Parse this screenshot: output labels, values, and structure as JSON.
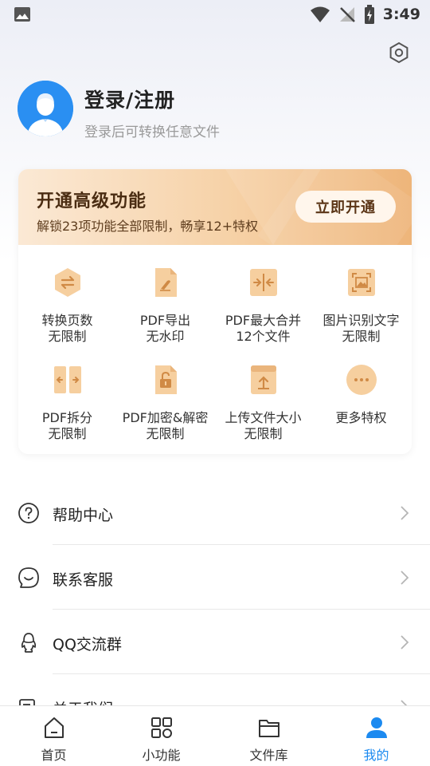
{
  "status_bar": {
    "time": "3:49"
  },
  "profile": {
    "title": "登录/注册",
    "subtitle": "登录后可转换任意文件"
  },
  "vip": {
    "title": "开通高级功能",
    "subtitle": "解锁23项功能全部限制，畅享12+特权",
    "button": "立即开通",
    "features": [
      {
        "icon": "convert-icon",
        "line1": "转换页数",
        "line2": "无限制"
      },
      {
        "icon": "pdf-export-icon",
        "line1": "PDF导出",
        "line2": "无水印"
      },
      {
        "icon": "merge-icon",
        "line1": "PDF最大合并",
        "line2": "12个文件"
      },
      {
        "icon": "image-ocr-icon",
        "line1": "图片识别文字",
        "line2": "无限制"
      },
      {
        "icon": "split-icon",
        "line1": "PDF拆分",
        "line2": "无限制"
      },
      {
        "icon": "lock-icon",
        "line1": "PDF加密&解密",
        "line2": "无限制"
      },
      {
        "icon": "upload-icon",
        "line1": "上传文件大小",
        "line2": "无限制"
      },
      {
        "icon": "more-icon",
        "line1": "更多特权",
        "line2": ""
      }
    ]
  },
  "menu": [
    {
      "label": "帮助中心",
      "icon": "help-icon"
    },
    {
      "label": "联系客服",
      "icon": "customer-service-icon"
    },
    {
      "label": "QQ交流群",
      "icon": "qq-icon"
    },
    {
      "label": "关于我们",
      "icon": "about-icon"
    }
  ],
  "bottom_nav": [
    {
      "label": "首页",
      "icon": "home-icon"
    },
    {
      "label": "小功能",
      "icon": "grid-icon"
    },
    {
      "label": "文件库",
      "icon": "folder-icon"
    },
    {
      "label": "我的",
      "icon": "user-icon",
      "active": true
    }
  ],
  "colors": {
    "accent": "#1c8af0",
    "vip_gradient_start": "#fbe9d5",
    "vip_gradient_end": "#eeb57a",
    "feature_icon": "#f3c797"
  }
}
